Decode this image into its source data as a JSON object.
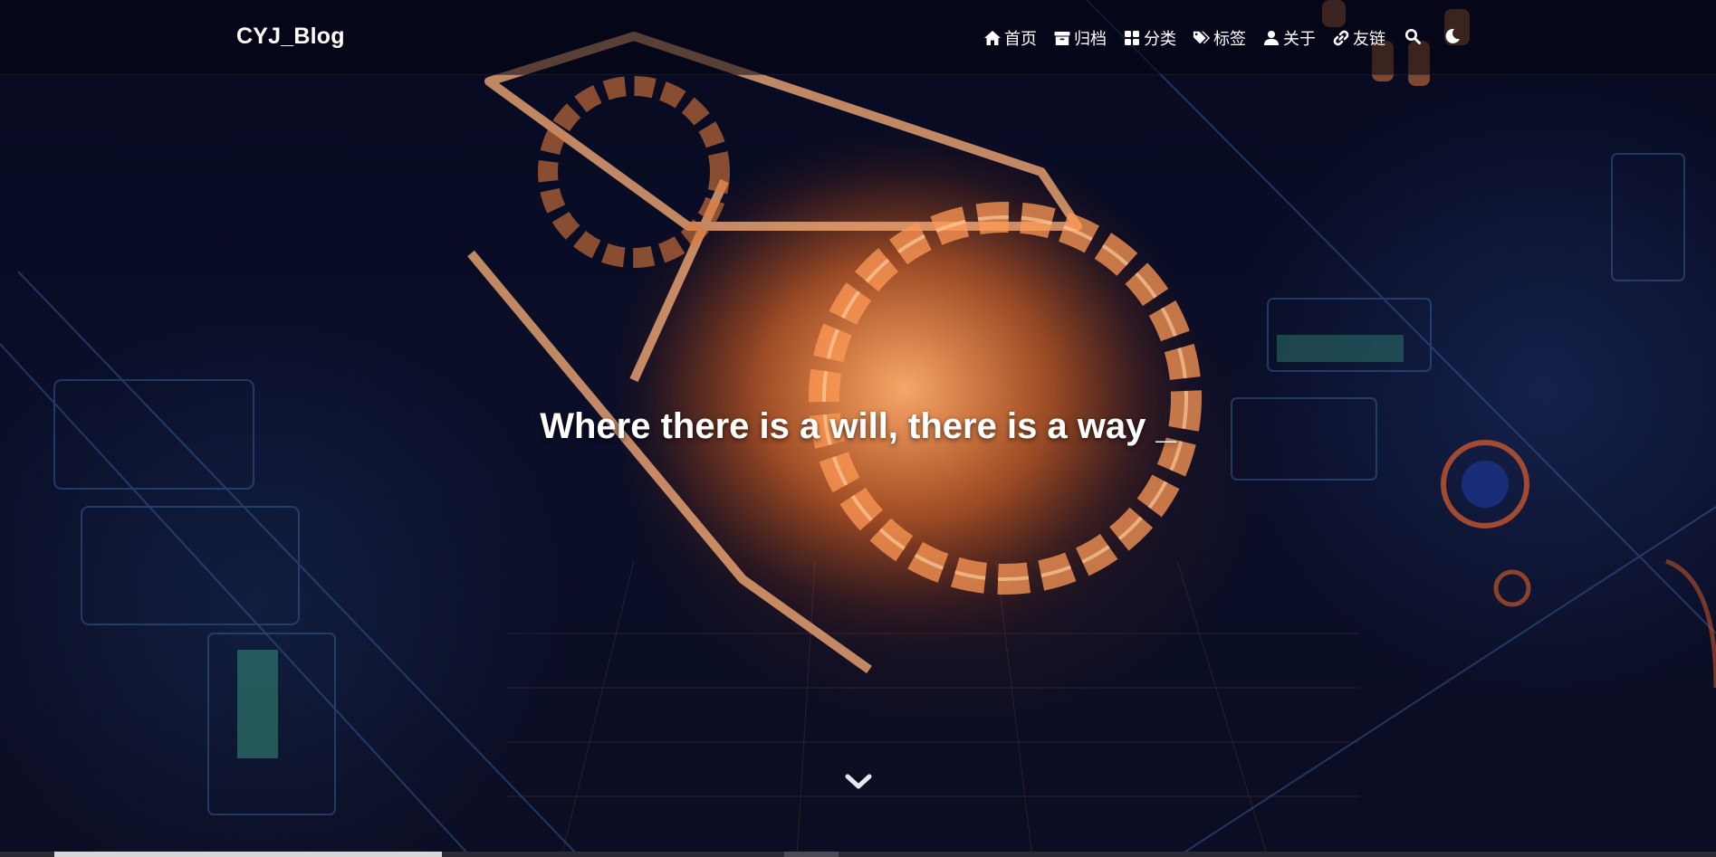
{
  "site": {
    "brand": "CYJ_Blog"
  },
  "nav": {
    "items": [
      {
        "label": "首页",
        "icon": "home-icon"
      },
      {
        "label": "归档",
        "icon": "archive-icon"
      },
      {
        "label": "分类",
        "icon": "category-icon"
      },
      {
        "label": "标签",
        "icon": "tags-icon"
      },
      {
        "label": "关于",
        "icon": "user-icon"
      },
      {
        "label": "友链",
        "icon": "link-icon"
      }
    ],
    "search_icon": "search-icon",
    "theme_icon": "moon-icon"
  },
  "hero": {
    "title": "Where there is a will, there is a way _",
    "scroll_icon": "chevron-down-icon"
  },
  "colors": {
    "text": "#ffffff",
    "accent_glow": "#ff8c3c",
    "background": "#070a20"
  }
}
